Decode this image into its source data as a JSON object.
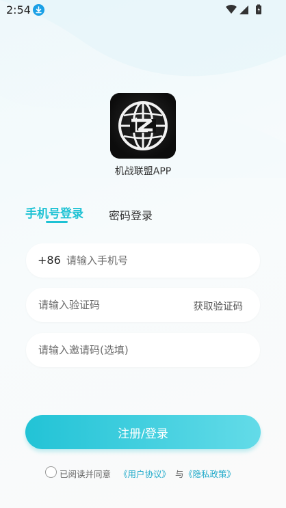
{
  "status_bar": {
    "time": "2:54",
    "icons": [
      "download-icon",
      "wifi-icon",
      "signal-icon",
      "battery-icon"
    ]
  },
  "app": {
    "name": "机战联盟APP",
    "logo_icon": "globe-logo-icon"
  },
  "tabs": [
    {
      "label": "手机号登录",
      "active": true
    },
    {
      "label": "密码登录",
      "active": false
    }
  ],
  "form": {
    "phone_prefix": "+86",
    "phone_placeholder": "请输入手机号",
    "code_placeholder": "请输入验证码",
    "get_code_label": "获取验证码",
    "invite_placeholder": "请输入邀请码(选填)"
  },
  "submit_label": "注册/登录",
  "agreement": {
    "prefix": "已阅读并同意",
    "user_agreement": "《用户协议》",
    "connector": "与",
    "privacy_policy": "《隐私政策》",
    "checked": false
  },
  "colors": {
    "accent": "#1ec2d4",
    "link": "#1ea9c9",
    "button_gradient_start": "#22c3d6",
    "button_gradient_end": "#63dbe8"
  }
}
